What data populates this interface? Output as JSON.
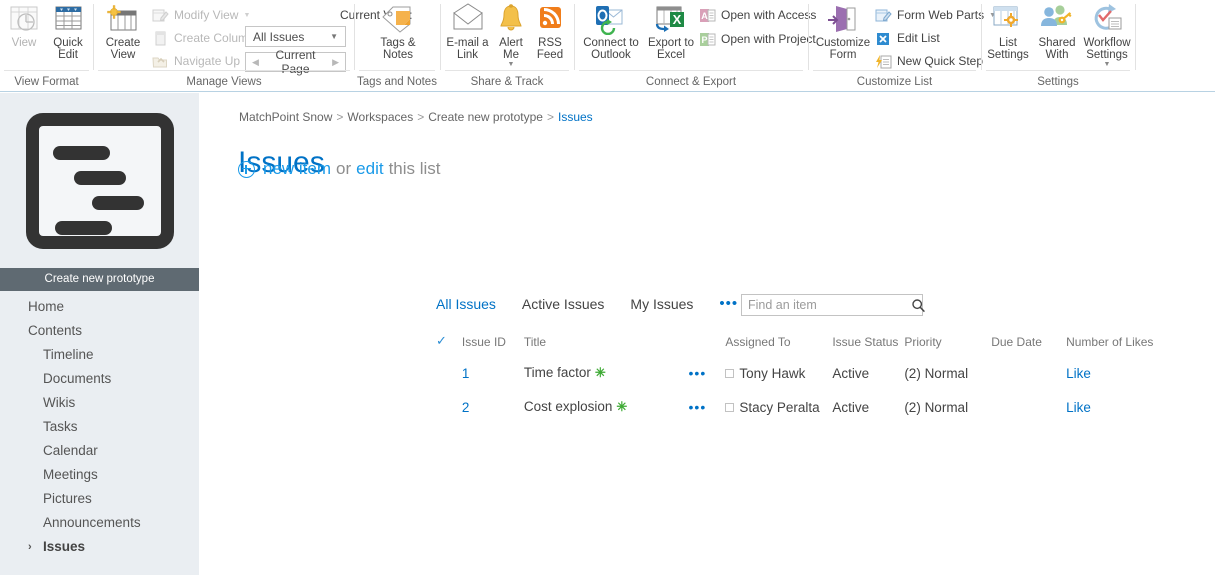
{
  "ribbon": {
    "groups": [
      {
        "label": "View Format",
        "big_buttons": [
          {
            "name": "view",
            "label": "View",
            "disabled": true
          },
          {
            "name": "quick-edit",
            "label": "Quick\nEdit",
            "disabled": false
          }
        ]
      },
      {
        "label": "Manage Views",
        "big_buttons": [
          {
            "name": "create-view",
            "label": "Create\nView",
            "disabled": false
          }
        ],
        "small_buttons": [
          {
            "name": "modify-view",
            "label": "Modify View",
            "disabled": true,
            "caret": true
          },
          {
            "name": "create-column",
            "label": "Create Column",
            "disabled": true,
            "caret": false
          },
          {
            "name": "navigate-up",
            "label": "Navigate Up",
            "disabled": true,
            "caret": false
          }
        ],
        "current_view_label": "Current View:",
        "view_select_value": "All Issues",
        "page_nav_label": "Current Page"
      },
      {
        "label": "Tags and Notes",
        "big_buttons": [
          {
            "name": "tags-notes",
            "label": "Tags &\nNotes",
            "disabled": false
          }
        ]
      },
      {
        "label": "Share & Track",
        "big_buttons": [
          {
            "name": "email-a-link",
            "label": "E-mail a\nLink",
            "disabled": false
          },
          {
            "name": "alert-me",
            "label": "Alert\nMe",
            "disabled": false,
            "caret": true
          },
          {
            "name": "rss-feed",
            "label": "RSS\nFeed",
            "disabled": false
          }
        ]
      },
      {
        "label": "Connect & Export",
        "big_buttons": [
          {
            "name": "connect-to-outlook",
            "label": "Connect to\nOutlook",
            "disabled": false
          },
          {
            "name": "export-to-excel",
            "label": "Export to\nExcel",
            "disabled": false
          }
        ],
        "small_buttons": [
          {
            "name": "open-with-access",
            "label": "Open with Access",
            "disabled": false,
            "caret": false
          },
          {
            "name": "open-with-project",
            "label": "Open with Project",
            "disabled": false,
            "caret": false
          }
        ]
      },
      {
        "label": "Customize List",
        "big_buttons": [
          {
            "name": "customize-form",
            "label": "Customize\nForm",
            "disabled": false
          }
        ],
        "small_buttons": [
          {
            "name": "form-web-parts",
            "label": "Form Web Parts",
            "disabled": false,
            "caret": true
          },
          {
            "name": "edit-list",
            "label": "Edit List",
            "disabled": false,
            "caret": false
          },
          {
            "name": "new-quick-step",
            "label": "New Quick Step",
            "disabled": false,
            "caret": false
          }
        ]
      },
      {
        "label": "Settings",
        "big_buttons": [
          {
            "name": "list-settings",
            "label": "List\nSettings",
            "disabled": false
          },
          {
            "name": "shared-with",
            "label": "Shared\nWith",
            "disabled": false
          },
          {
            "name": "workflow-settings",
            "label": "Workflow\nSettings",
            "disabled": false,
            "caret": true
          }
        ]
      }
    ]
  },
  "sidebar": {
    "site_title": "Create new prototype",
    "logo_icon": "document-outline-icon",
    "items": [
      {
        "label": "Home",
        "level": 0,
        "selected": false
      },
      {
        "label": "Contents",
        "level": 0,
        "selected": false
      },
      {
        "label": "Timeline",
        "level": 1,
        "selected": false
      },
      {
        "label": "Documents",
        "level": 1,
        "selected": false
      },
      {
        "label": "Wikis",
        "level": 1,
        "selected": false
      },
      {
        "label": "Tasks",
        "level": 1,
        "selected": false
      },
      {
        "label": "Calendar",
        "level": 1,
        "selected": false
      },
      {
        "label": "Meetings",
        "level": 1,
        "selected": false
      },
      {
        "label": "Pictures",
        "level": 1,
        "selected": false
      },
      {
        "label": "Announcements",
        "level": 1,
        "selected": false
      },
      {
        "label": "Issues",
        "level": 1,
        "selected": true
      }
    ]
  },
  "breadcrumb": {
    "items": [
      "MatchPoint Snow",
      "Workspaces",
      "Create new prototype",
      "Issues"
    ],
    "separator": ">"
  },
  "page": {
    "title": "Issues",
    "new_item_label": "new item",
    "or_label": "or",
    "edit_label": "edit",
    "this_list_label": "this list"
  },
  "views": {
    "tabs": [
      {
        "label": "All Issues",
        "active": true
      },
      {
        "label": "Active Issues",
        "active": false
      },
      {
        "label": "My Issues",
        "active": false
      }
    ],
    "more_label": "•••"
  },
  "search": {
    "placeholder": "Find an item",
    "value": "",
    "icon": "search-icon"
  },
  "list": {
    "columns": [
      "Issue ID",
      "Title",
      "Assigned To",
      "Issue Status",
      "Priority",
      "Due Date",
      "Number of Likes"
    ],
    "select_all_icon": "checkmark-icon",
    "rows": [
      {
        "issue_id": "1",
        "title": "Time factor",
        "is_new": true,
        "new_badge": "✳",
        "ellipsis": "•••",
        "assigned_to": "Tony Hawk",
        "issue_status": "Active",
        "priority": "(2) Normal",
        "due_date": "",
        "likes": "Like"
      },
      {
        "issue_id": "2",
        "title": "Cost explosion",
        "is_new": true,
        "new_badge": "✳",
        "ellipsis": "•••",
        "assigned_to": "Stacy Peralta",
        "issue_status": "Active",
        "priority": "(2) Normal",
        "due_date": "",
        "likes": "Like"
      }
    ]
  },
  "colors": {
    "accent_blue": "#0072c6",
    "link_blue": "#1a9ae8",
    "sidebar_bg": "#eaeef2",
    "site_title_bg": "#5f6a72",
    "new_badge_green": "#3faa35"
  }
}
